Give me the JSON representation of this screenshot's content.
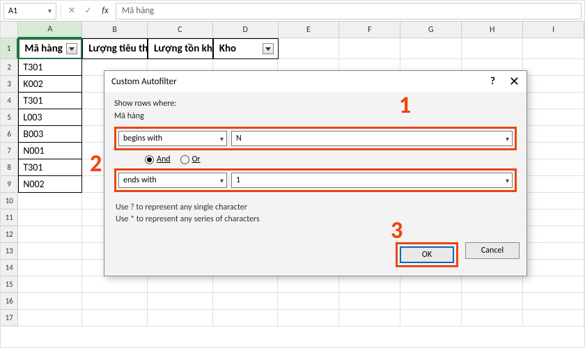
{
  "formula_bar": {
    "namebox": "A1",
    "formula": "Mã hàng"
  },
  "columns": [
    "A",
    "B",
    "C",
    "D",
    "E",
    "F",
    "G",
    "H",
    "I"
  ],
  "row_numbers": [
    1,
    2,
    3,
    4,
    5,
    6,
    7,
    8,
    9,
    10,
    11,
    12,
    13,
    14,
    15,
    16,
    17
  ],
  "headers": {
    "A": "Mã hàng",
    "B": "Lượng tiêu thụ",
    "C": "Lượng tồn kho",
    "D": "Kho"
  },
  "data_A": [
    "T301",
    "K002",
    "T301",
    "L003",
    "B003",
    "N001",
    "T301",
    "N002"
  ],
  "dialog": {
    "title": "Custom Autofilter",
    "show_rows_label": "Show rows where:",
    "field_label": "Mã hàng",
    "cond1_op": "begins with",
    "cond1_val": "N",
    "and_label": "And",
    "or_label": "Or",
    "cond2_op": "ends with",
    "cond2_val": "1",
    "hint1": "Use ? to represent any single character",
    "hint2": "Use * to represent any series of characters",
    "ok": "OK",
    "cancel": "Cancel",
    "help": "?",
    "close": "✕"
  },
  "annotations": {
    "a1": "1",
    "a2": "2",
    "a3": "3"
  }
}
